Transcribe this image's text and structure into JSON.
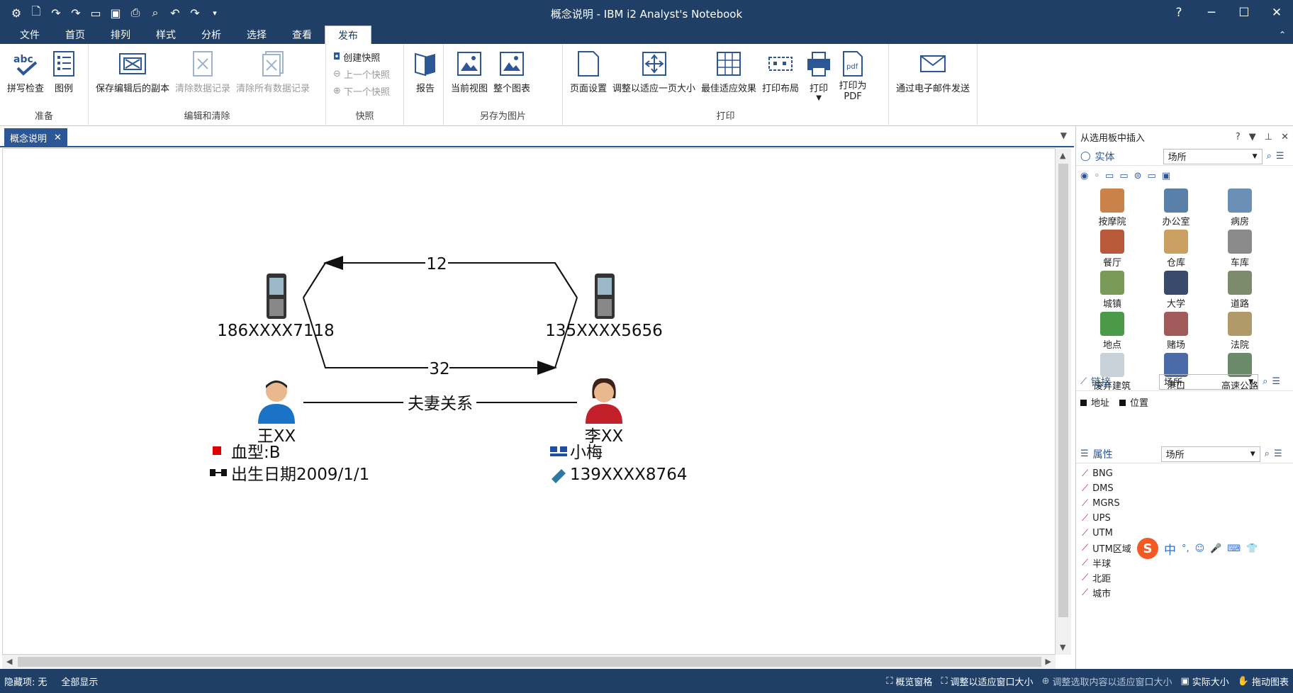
{
  "window": {
    "title": "概念说明 - IBM i2 Analyst's Notebook",
    "help": "?",
    "minimize": "─",
    "maximize": "☐",
    "close": "✕"
  },
  "qat": [
    "gear-icon",
    "new-icon",
    "redo-icon",
    "redo-link-icon",
    "open-icon",
    "save-icon",
    "print-icon",
    "search-icon",
    "undo-icon",
    "redo2-icon",
    "dropdown-icon"
  ],
  "menu": [
    "文件",
    "首页",
    "排列",
    "样式",
    "分析",
    "选择",
    "查看",
    "发布"
  ],
  "ribbon": {
    "groups": {
      "prepare": {
        "label": "准备",
        "spell": "拼写检查",
        "legend": "图例"
      },
      "edit": {
        "label": "编辑和清除",
        "save_copy": "保存编辑后的副本",
        "clear_data": "清除数据记录",
        "clear_all": "清除所有数据记录"
      },
      "snapshot": {
        "label": "快照",
        "create": "创建快照",
        "prev": "上一个快照",
        "next": "下一个快照"
      },
      "report": {
        "report": "报告"
      },
      "saveimg": {
        "label": "另存为图片",
        "current": "当前视图",
        "whole": "整个图表"
      },
      "print": {
        "label": "打印",
        "page_setup": "页面设置",
        "fit_page": "调整以适应一页大小",
        "best_fit": "最佳适应效果",
        "layout": "打印布局",
        "print": "打印",
        "print_pdf": "打印为\nPDF"
      },
      "email": {
        "send": "通过电子邮件发送"
      }
    }
  },
  "doc_tab": {
    "title": "概念说明",
    "close": "✕"
  },
  "chart": {
    "phone1": "186XXXX7118",
    "phone2": "135XXXX5656",
    "link_top": "12",
    "link_bottom": "32",
    "person1": "王XX",
    "person2": "李XX",
    "relation": "夫妻关系",
    "attr1": "血型:B",
    "attr2": "出生日期2009/1/1",
    "attr3": "小梅",
    "attr4": "139XXXX8764"
  },
  "panel": {
    "title": "从选用板中插入",
    "entity": {
      "label": "实体",
      "value": "场所"
    },
    "items": [
      [
        "按摩院",
        "办公室",
        "病房"
      ],
      [
        "餐厅",
        "仓库",
        "车库"
      ],
      [
        "城镇",
        "大学",
        "道路"
      ],
      [
        "地点",
        "赌场",
        "法院"
      ],
      [
        "废弃建筑",
        "港口",
        "高速公路"
      ]
    ],
    "link": {
      "label": "链接",
      "value": "场所",
      "options": [
        "地址",
        "位置"
      ]
    },
    "attr": {
      "label": "属性",
      "value": "场所",
      "items": [
        "BNG",
        "DMS",
        "MGRS",
        "UPS",
        "UTM",
        "UTM区域",
        "半球",
        "北距",
        "城市"
      ]
    }
  },
  "ime": {
    "items": [
      "中",
      "°,",
      "☺",
      "🎤",
      "⌨",
      "👕"
    ]
  },
  "status": {
    "hidden_label": "隐藏项:",
    "hidden_value": "无",
    "show_all": "全部显示",
    "overview": "概览窗格",
    "fit_window": "调整以适应窗口大小",
    "fit_selection": "调整选取内容以适应窗口大小",
    "actual": "实际大小",
    "drag": "拖动图表"
  },
  "colors": {
    "titlebar": "#1f3f66",
    "accent": "#2b5797"
  }
}
